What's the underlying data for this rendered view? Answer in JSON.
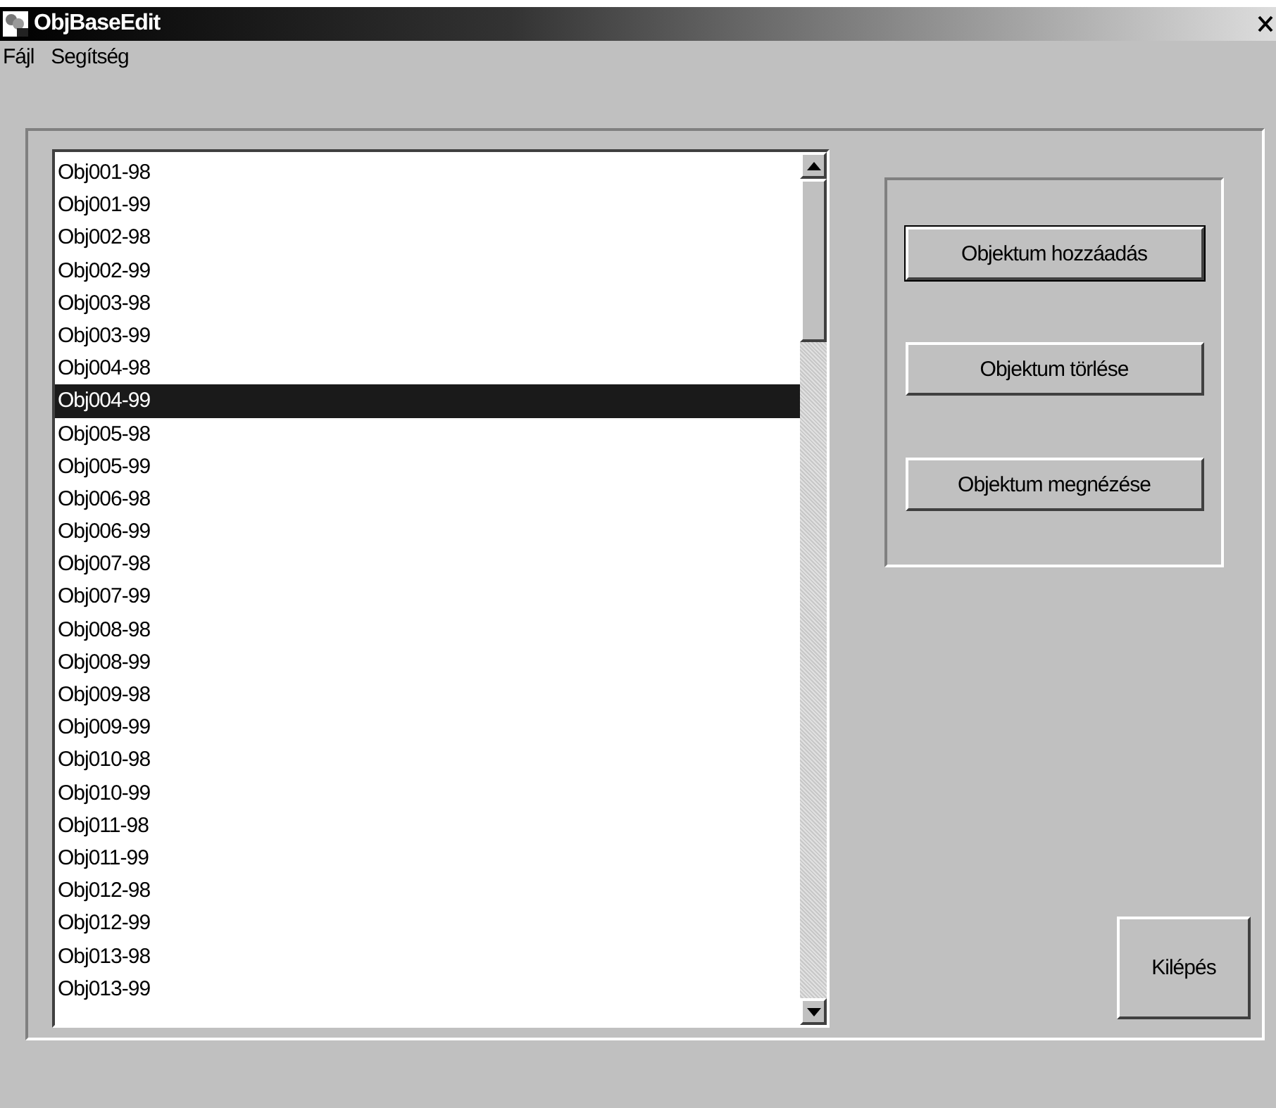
{
  "window": {
    "title": "ObjBaseEdit"
  },
  "menu": [
    "Fájl",
    "Segítség"
  ],
  "list": {
    "items": [
      {
        "label": "Obj001-98",
        "selected": false
      },
      {
        "label": "Obj001-99",
        "selected": false
      },
      {
        "label": "Obj002-98",
        "selected": false
      },
      {
        "label": "Obj002-99",
        "selected": false
      },
      {
        "label": "Obj003-98",
        "selected": false
      },
      {
        "label": "Obj003-99",
        "selected": false
      },
      {
        "label": "Obj004-98",
        "selected": false
      },
      {
        "label": "Obj004-99",
        "selected": true
      },
      {
        "label": "Obj005-98",
        "selected": false
      },
      {
        "label": "Obj005-99",
        "selected": false
      },
      {
        "label": "Obj006-98",
        "selected": false
      },
      {
        "label": "Obj006-99",
        "selected": false
      },
      {
        "label": "Obj007-98",
        "selected": false
      },
      {
        "label": "Obj007-99",
        "selected": false
      },
      {
        "label": "Obj008-98",
        "selected": false
      },
      {
        "label": "Obj008-99",
        "selected": false
      },
      {
        "label": "Obj009-98",
        "selected": false
      },
      {
        "label": "Obj009-99",
        "selected": false
      },
      {
        "label": "Obj010-98",
        "selected": false
      },
      {
        "label": "Obj010-99",
        "selected": false
      },
      {
        "label": "Obj011-98",
        "selected": false
      },
      {
        "label": "Obj011-99",
        "selected": false
      },
      {
        "label": "Obj012-98",
        "selected": false
      },
      {
        "label": "Obj012-99",
        "selected": false
      },
      {
        "label": "Obj013-98",
        "selected": false
      },
      {
        "label": "Obj013-99",
        "selected": false
      }
    ]
  },
  "buttons": [
    {
      "label": "Objektum hozzáadás",
      "default": true
    },
    {
      "label": "Objektum törlése",
      "default": false
    },
    {
      "label": "Objektum megnézése",
      "default": false
    }
  ],
  "exit_button": "Kilépés"
}
